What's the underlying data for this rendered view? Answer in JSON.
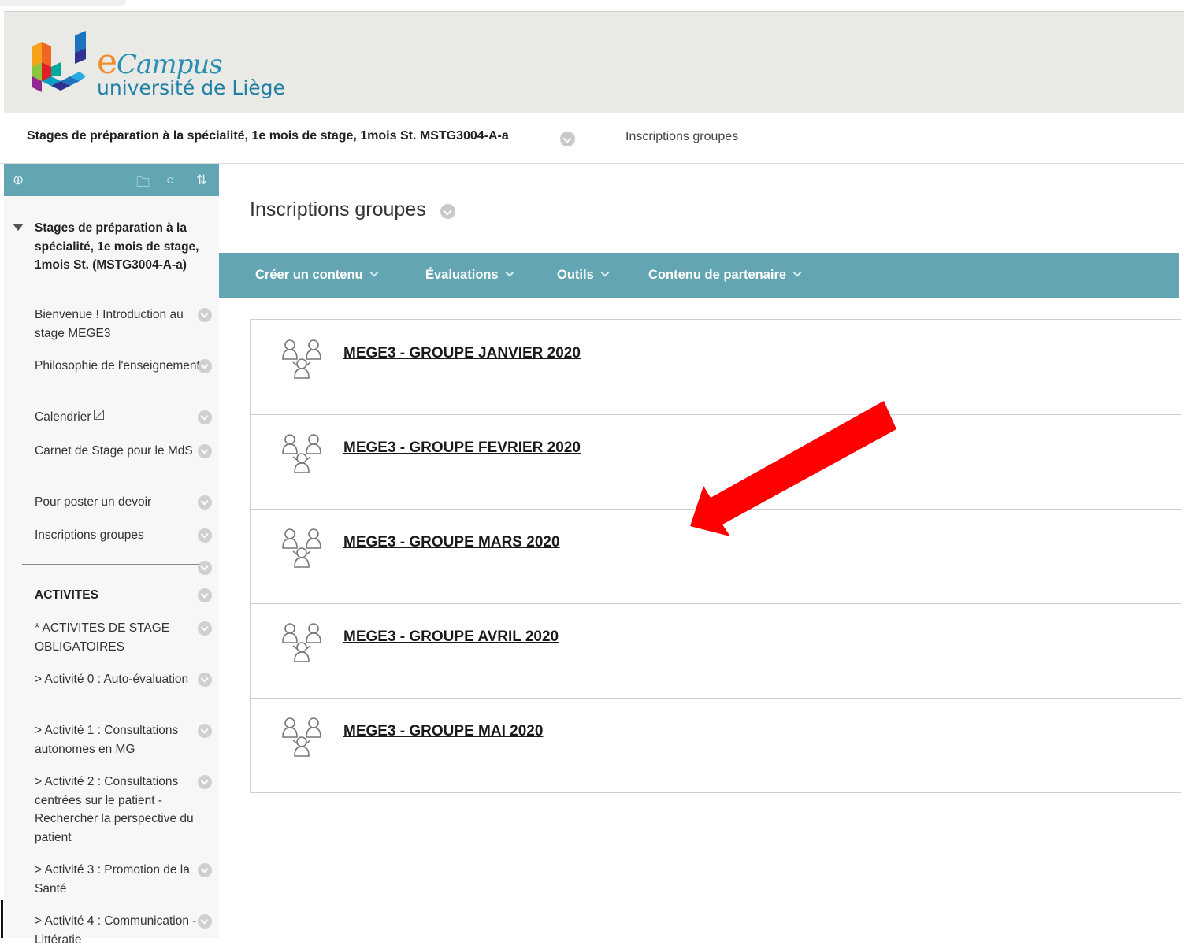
{
  "header": {
    "logo_brand": "Campus",
    "logo_brand_e": "e",
    "logo_university": "université de Liège"
  },
  "course_bar": {
    "title": "Stages de préparation à la spécialité, 1e mois de stage, 1mois St. MSTG3004-A-a",
    "breadcrumb": "Inscriptions groupes"
  },
  "sidebar": {
    "toolbar_icons": [
      "add-circle-icon",
      "folder-icon",
      "refresh-icon",
      "sort-icon"
    ],
    "course_name": "Stages de préparation à la spécialité, 1e mois de stage, 1mois St. (MSTG3004-A-a)",
    "items": [
      {
        "label": "Bienvenue ! Introduction au stage MEGE3",
        "bold": false
      },
      {
        "label": "Philosophie de l'enseignement",
        "bold": false
      },
      {
        "label": "Calendrier",
        "bold": false
      },
      {
        "label": "Carnet de Stage pour le MdS",
        "bold": false
      },
      {
        "label": "Pour poster un devoir",
        "bold": false
      },
      {
        "label": "Inscriptions groupes",
        "bold": false
      },
      {
        "label": "ACTIVITES",
        "bold": true
      },
      {
        "label": "* ACTIVITES DE STAGE OBLIGATOIRES",
        "bold": false
      },
      {
        "label": "> Activité 0 : Auto-évaluation",
        "bold": false
      },
      {
        "label": "> Activité 1 : Consultations autonomes en MG",
        "bold": false
      },
      {
        "label": "> Activité 2 : Consultations centrées sur le patient - Rechercher la perspective du patient",
        "bold": false
      },
      {
        "label": "> Activité 3 : Promotion de la Santé",
        "bold": false
      },
      {
        "label": "> Activité 4 : Communication - Littératie",
        "bold": false
      }
    ]
  },
  "main": {
    "page_title": "Inscriptions groupes",
    "actions": [
      {
        "label": "Créer un contenu"
      },
      {
        "label": "Évaluations"
      },
      {
        "label": "Outils"
      },
      {
        "label": "Contenu de partenaire"
      }
    ],
    "groups": [
      {
        "label": "MEGE3 - GROUPE JANVIER 2020"
      },
      {
        "label": "MEGE3 - GROUPE FEVRIER 2020"
      },
      {
        "label": "MEGE3 - GROUPE MARS 2020"
      },
      {
        "label": "MEGE3 - GROUPE AVRIL 2020"
      },
      {
        "label": "MEGE3 - GROUPE MAI 2020"
      }
    ]
  },
  "annotation": {
    "arrow_color": "#ff0000"
  }
}
